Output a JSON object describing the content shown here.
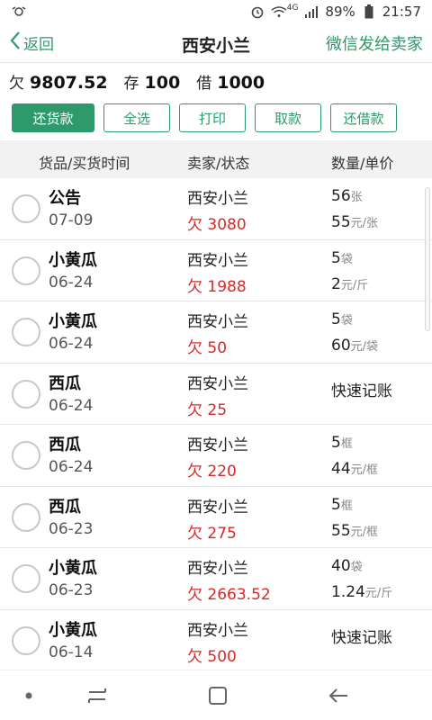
{
  "status_bar": {
    "network_label": "4G",
    "battery": "89%",
    "time": "21:57",
    "icons": [
      "sync-icon",
      "alarm-icon",
      "wifi-icon",
      "signal-icon",
      "battery-icon"
    ]
  },
  "nav": {
    "back_label": "返回",
    "title": "西安小兰",
    "action_label": "微信发给卖家"
  },
  "summary": {
    "owe_label": "欠",
    "owe_value": "9807.52",
    "stock_label": "存",
    "stock_value": "100",
    "borrow_label": "借",
    "borrow_value": "1000"
  },
  "actions": [
    {
      "label": "还货款",
      "primary": true,
      "width": 92
    },
    {
      "label": "全选",
      "primary": false,
      "width": 74
    },
    {
      "label": "打印",
      "primary": false,
      "width": 74
    },
    {
      "label": "取款",
      "primary": false,
      "width": 74
    },
    {
      "label": "还借款",
      "primary": false,
      "width": 74
    }
  ],
  "table_header": {
    "col1": "货品/买货时间",
    "col2": "卖家/状态",
    "col3": "数量/单价"
  },
  "rows": [
    {
      "name": "公告",
      "date": "07-09",
      "seller": "西安小兰",
      "owe": "欠 3080",
      "qty": "56",
      "qty_unit": "张",
      "price": "55",
      "price_unit": "元/张",
      "quick": ""
    },
    {
      "name": "小黄瓜",
      "date": "06-24",
      "seller": "西安小兰",
      "owe": "欠 1988",
      "qty": "5",
      "qty_unit": "袋",
      "price": "2",
      "price_unit": "元/斤",
      "quick": ""
    },
    {
      "name": "小黄瓜",
      "date": "06-24",
      "seller": "西安小兰",
      "owe": "欠 50",
      "qty": "5",
      "qty_unit": "袋",
      "price": "60",
      "price_unit": "元/袋",
      "quick": ""
    },
    {
      "name": "西瓜",
      "date": "06-24",
      "seller": "西安小兰",
      "owe": "欠 25",
      "qty": "",
      "qty_unit": "",
      "price": "",
      "price_unit": "",
      "quick": "快速记账"
    },
    {
      "name": "西瓜",
      "date": "06-24",
      "seller": "西安小兰",
      "owe": "欠 220",
      "qty": "5",
      "qty_unit": "框",
      "price": "44",
      "price_unit": "元/框",
      "quick": ""
    },
    {
      "name": "西瓜",
      "date": "06-23",
      "seller": "西安小兰",
      "owe": "欠 275",
      "qty": "5",
      "qty_unit": "框",
      "price": "55",
      "price_unit": "元/框",
      "quick": ""
    },
    {
      "name": "小黄瓜",
      "date": "06-23",
      "seller": "西安小兰",
      "owe": "欠 2663.52",
      "qty": "40",
      "qty_unit": "袋",
      "price": "1.24",
      "price_unit": "元/斤",
      "quick": ""
    },
    {
      "name": "小黄瓜",
      "date": "06-14",
      "seller": "西安小兰",
      "owe": "欠 500",
      "qty": "",
      "qty_unit": "",
      "price": "",
      "price_unit": "",
      "quick": "快速记账"
    }
  ],
  "colors": {
    "accent": "#2e9a6b",
    "owe_red": "#d42a2a"
  },
  "system_nav": [
    "dot-icon",
    "recent-apps-icon",
    "home-icon",
    "back-arrow-icon"
  ]
}
